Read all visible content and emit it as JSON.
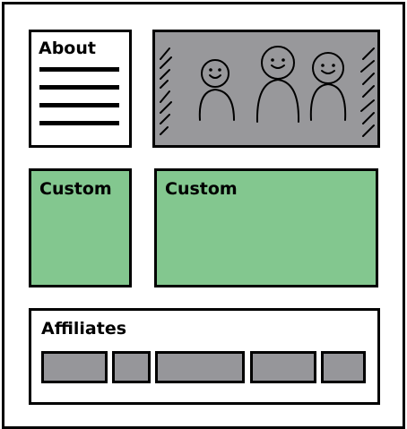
{
  "about": {
    "title": "About",
    "text_line_count": 4
  },
  "photo": {
    "fill": "#98989b",
    "subject": "three-people-sketch"
  },
  "custom_left": {
    "title": "Custom",
    "fill": "#83c78f"
  },
  "custom_right": {
    "title": "Custom",
    "fill": "#83c78f"
  },
  "affiliates": {
    "title": "Affiliates",
    "logo_count": 5,
    "logo_fill": "#96969a"
  }
}
